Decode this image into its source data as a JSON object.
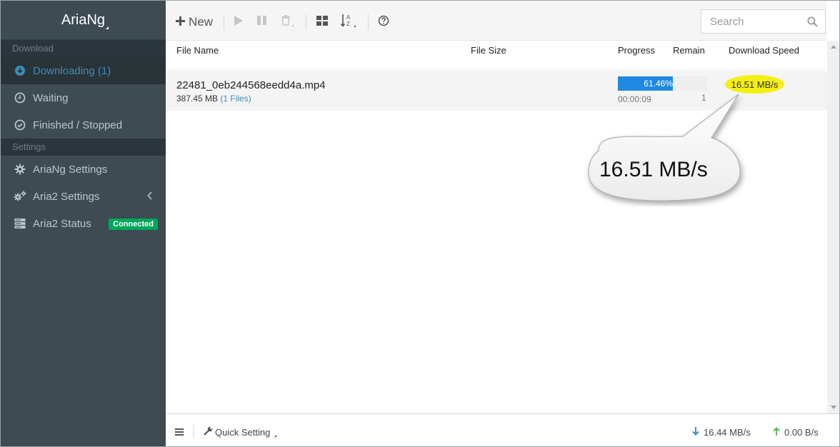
{
  "brand": {
    "title": "AriaNg"
  },
  "sidebar": {
    "download_header": "Download",
    "settings_header": "Settings",
    "items": [
      {
        "label": "Downloading (1)",
        "icon": "download-circle-icon"
      },
      {
        "label": "Waiting",
        "icon": "clock-icon"
      },
      {
        "label": "Finished / Stopped",
        "icon": "check-circle-icon"
      },
      {
        "label": "AriaNg Settings",
        "icon": "gear-icon"
      },
      {
        "label": "Aria2 Settings",
        "icon": "gears-icon"
      },
      {
        "label": "Aria2 Status",
        "icon": "server-icon",
        "badge": "Connected"
      }
    ]
  },
  "toolbar": {
    "new_label": "New",
    "search_placeholder": "Search"
  },
  "columns": {
    "file_name": "File Name",
    "file_size": "File Size",
    "progress": "Progress",
    "remain": "Remain",
    "download_speed": "Download Speed"
  },
  "tasks": [
    {
      "file_name": "22481_0eb244568eedd4a.mp4",
      "size": "387.45 MB",
      "files": "(1 Files)",
      "progress_text": "61.46%",
      "progress_fraction": 0.6146,
      "elapsed": "00:00:09",
      "remain": "1",
      "speed": "16.51 MB/s"
    }
  ],
  "callout": {
    "text": "16.51 MB/s"
  },
  "footer": {
    "quick_setting": "Quick Setting",
    "download_speed": "16.44 MB/s",
    "upload_speed": "0.00 B/s"
  },
  "colors": {
    "sidebar_bg": "#3e4b53",
    "accent": "#3c8dbc",
    "progress": "#2089e0",
    "badge": "#00a65a",
    "highlight": "#f4ef12"
  }
}
